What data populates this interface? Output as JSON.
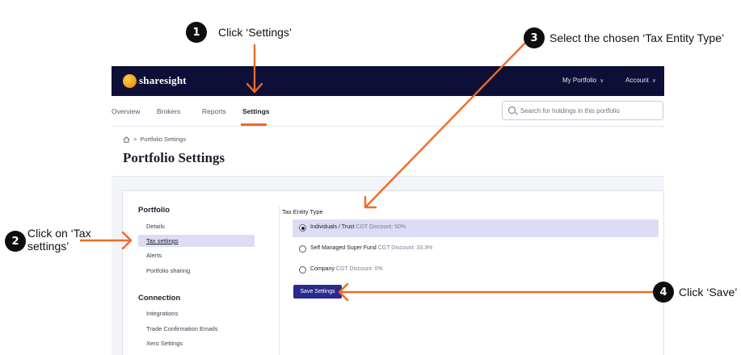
{
  "annotations": {
    "step1": {
      "number": "1",
      "text": "Click ‘Settings’"
    },
    "step2": {
      "number": "2",
      "text_line1": "Click on ‘Tax",
      "text_line2": "settings’"
    },
    "step3": {
      "number": "3",
      "text": "Select the chosen ‘Tax Entity Type’"
    },
    "step4": {
      "number": "4",
      "text": "Click ‘Save’"
    },
    "arrow_color": "#f06a26"
  },
  "header": {
    "brand": "sharesight",
    "menu": [
      {
        "label": "My Portfolio"
      },
      {
        "label": "Account"
      }
    ]
  },
  "tabs": [
    {
      "label": "Overview"
    },
    {
      "label": "Brokers"
    },
    {
      "label": "Reports"
    },
    {
      "label": "Settings",
      "active": true
    }
  ],
  "search": {
    "placeholder": "Search for holdings in this portfolio",
    "value": ""
  },
  "breadcrumb": {
    "current": "Portfolio Settings"
  },
  "page_title": "Portfolio Settings",
  "sidebar": {
    "portfolio_title": "Portfolio",
    "portfolio_items": [
      {
        "label": "Details"
      },
      {
        "label": "Tax settings",
        "active": true
      },
      {
        "label": "Alerts"
      },
      {
        "label": "Portfolio sharing"
      }
    ],
    "connection_title": "Connection",
    "connection_items": [
      {
        "label": "Integrations"
      },
      {
        "label": "Trade Confirmation Emails"
      },
      {
        "label": "Xero Settings"
      }
    ]
  },
  "tax_entity": {
    "label": "Tax Entity Type",
    "options": [
      {
        "name": "Individuals / Trust",
        "hint": "CGT Discount: 50%",
        "selected": true
      },
      {
        "name": "Self Managed Super Fund",
        "hint": "CGT Discount: 33.3%",
        "selected": false
      },
      {
        "name": "Company",
        "hint": "CGT Discount: 0%",
        "selected": false
      }
    ]
  },
  "save_button": "Save Settings",
  "colors": {
    "topbar": "#0d0f36",
    "accent": "#f06a26",
    "primary_button": "#2a2a8e",
    "selected_row": "#dcdcf4"
  }
}
